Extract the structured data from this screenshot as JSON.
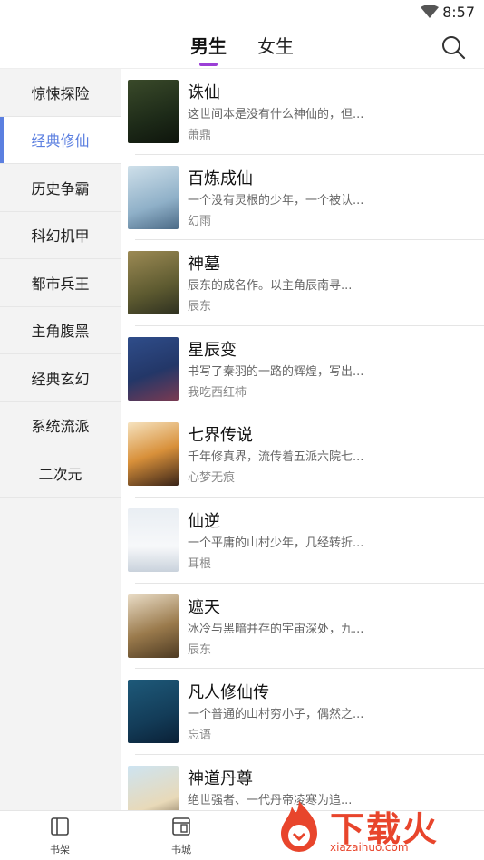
{
  "status": {
    "time": "8:57",
    "wifi_icon": "wifi-icon"
  },
  "header": {
    "tab_male": "男生",
    "tab_female": "女生",
    "search_icon": "search-icon",
    "accent": "#9b3fd6"
  },
  "sidebar": {
    "items": [
      {
        "label": "惊悚探险"
      },
      {
        "label": "经典修仙"
      },
      {
        "label": "历史争霸"
      },
      {
        "label": "科幻机甲"
      },
      {
        "label": "都市兵王"
      },
      {
        "label": "主角腹黑"
      },
      {
        "label": "经典玄幻"
      },
      {
        "label": "系统流派"
      },
      {
        "label": "二次元"
      }
    ],
    "active_color": "#5b7fe0"
  },
  "books": [
    {
      "title": "诛仙",
      "desc": "这世间本是没有什么神仙的，但...",
      "author": "萧鼎"
    },
    {
      "title": "百炼成仙",
      "desc": "一个没有灵根的少年，一个被认...",
      "author": "幻雨"
    },
    {
      "title": "神墓",
      "desc": "辰东的成名作。以主角辰南寻...",
      "author": "辰东"
    },
    {
      "title": "星辰变",
      "desc": "书写了秦羽的一路的辉煌，写出...",
      "author": "我吃西红柿"
    },
    {
      "title": "七界传说",
      "desc": "千年修真界，流传着五派六院七...",
      "author": "心梦无痕"
    },
    {
      "title": "仙逆",
      "desc": "一个平庸的山村少年，几经转折...",
      "author": "耳根"
    },
    {
      "title": "遮天",
      "desc": "冰冷与黑暗并存的宇宙深处，九...",
      "author": "辰东"
    },
    {
      "title": "凡人修仙传",
      "desc": "一个普通的山村穷小子，偶然之...",
      "author": "忘语"
    },
    {
      "title": "神道丹尊",
      "desc": "绝世强者、一代丹帝凌寒为追...",
      "author": ""
    }
  ],
  "bottom_nav": {
    "shelf": "书架",
    "store": "书城"
  },
  "watermark": {
    "text": "下载火",
    "url": "xiazaihuo.com"
  }
}
